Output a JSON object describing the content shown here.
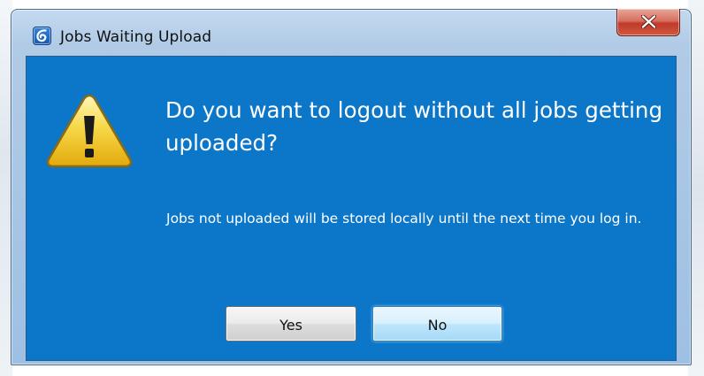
{
  "window": {
    "title": "Jobs Waiting Upload",
    "close_icon": "close-icon",
    "app_icon": "app-logo-icon"
  },
  "dialog": {
    "icon": "warning-icon",
    "heading": "Do you want to logout without all jobs getting uploaded?",
    "message": "Jobs not uploaded will be stored locally until the next time you log in.",
    "buttons": {
      "yes_label": "Yes",
      "no_label": "No",
      "default": "No"
    }
  },
  "colors": {
    "client_background": "#0c76c8",
    "close_button": "#c1392a",
    "default_button": "#bee6fd"
  }
}
